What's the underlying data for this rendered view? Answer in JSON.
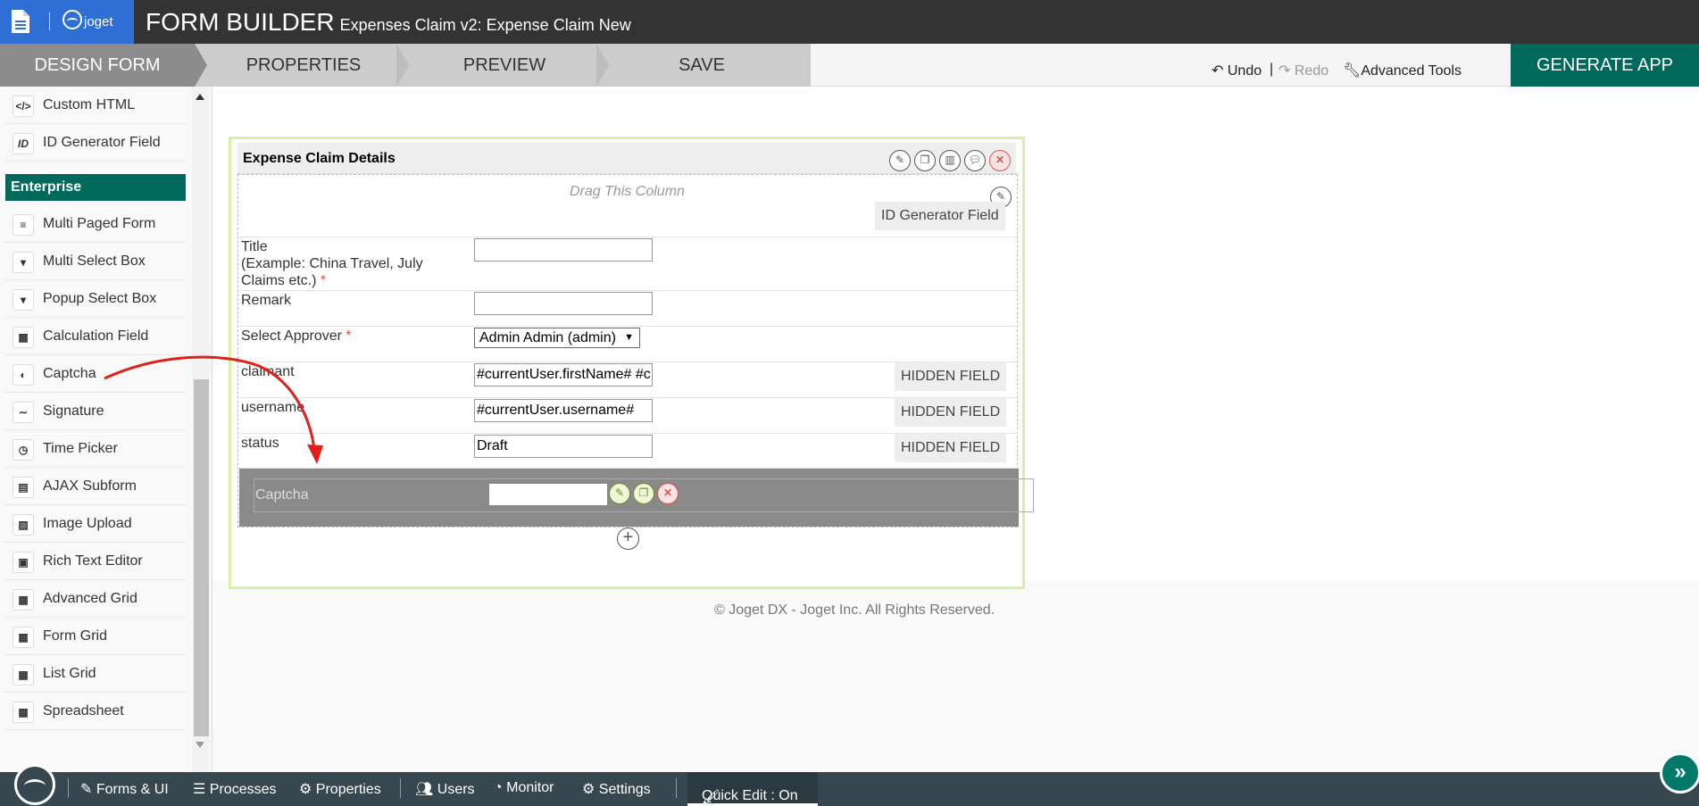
{
  "header": {
    "logo_text": "joget",
    "title": "FORM BUILDER",
    "subtitle": "Expenses Claim v2: Expense Claim New"
  },
  "steps": [
    "DESIGN FORM",
    "PROPERTIES",
    "PREVIEW",
    "SAVE"
  ],
  "toolbar": {
    "undo": "Undo",
    "divider": "|",
    "redo": "Redo",
    "advanced_tools": "Advanced Tools",
    "generate_app": "GENERATE APP"
  },
  "palette": {
    "top_items": [
      {
        "label": "Custom HTML",
        "icon": "</>"
      },
      {
        "label": "ID Generator Field",
        "icon": "ID"
      }
    ],
    "section": "Enterprise",
    "items": [
      {
        "label": "Multi Paged Form",
        "icon": "≡"
      },
      {
        "label": "Multi Select Box",
        "icon": "▾"
      },
      {
        "label": "Popup Select Box",
        "icon": "▾"
      },
      {
        "label": "Calculation Field",
        "icon": "▦"
      },
      {
        "label": "Captcha",
        "icon": "◐"
      },
      {
        "label": "Signature",
        "icon": "∼"
      },
      {
        "label": "Time Picker",
        "icon": "◷"
      },
      {
        "label": "AJAX Subform",
        "icon": "▤"
      },
      {
        "label": "Image Upload",
        "icon": "▨"
      },
      {
        "label": "Rich Text Editor",
        "icon": "▣"
      },
      {
        "label": "Advanced Grid",
        "icon": "▦"
      },
      {
        "label": "Form Grid",
        "icon": "▦"
      },
      {
        "label": "List Grid",
        "icon": "▦"
      },
      {
        "label": "Spreadsheet",
        "icon": "▦"
      }
    ]
  },
  "form": {
    "section_title": "Expense Claim Details",
    "drag_column": "Drag This Column",
    "id_generator_badge": "ID Generator Field",
    "fields": {
      "title_label": "Title",
      "title_hint_1": "(Example: China Travel, July",
      "title_hint_2": "Claims etc.)",
      "required_mark": "*",
      "remark_label": "Remark",
      "approver_label": "Select Approver",
      "approver_value": "Admin Admin (admin)",
      "claimant_label": "claimant",
      "claimant_value": "#currentUser.firstName# #c",
      "username_label": "username",
      "username_value": "#currentUser.username#",
      "status_label": "status",
      "status_value": "Draft",
      "hidden_badge": "HIDDEN FIELD"
    },
    "drop_zone_label": "Captcha",
    "footer": "© Joget DX - Joget Inc. All Rights Reserved."
  },
  "bottombar": {
    "forms_ui": "Forms & UI",
    "processes": "Processes",
    "properties": "Properties",
    "users": "Users",
    "monitor": "Monitor",
    "settings": "Settings",
    "quick_edit": "Quick Edit : On"
  },
  "colors": {
    "accent": "#00695c",
    "topbar": "#333333",
    "doc_button": "#2e6fd6",
    "bottombar": "#36474f",
    "annotation_arrow": "#e0201b"
  }
}
